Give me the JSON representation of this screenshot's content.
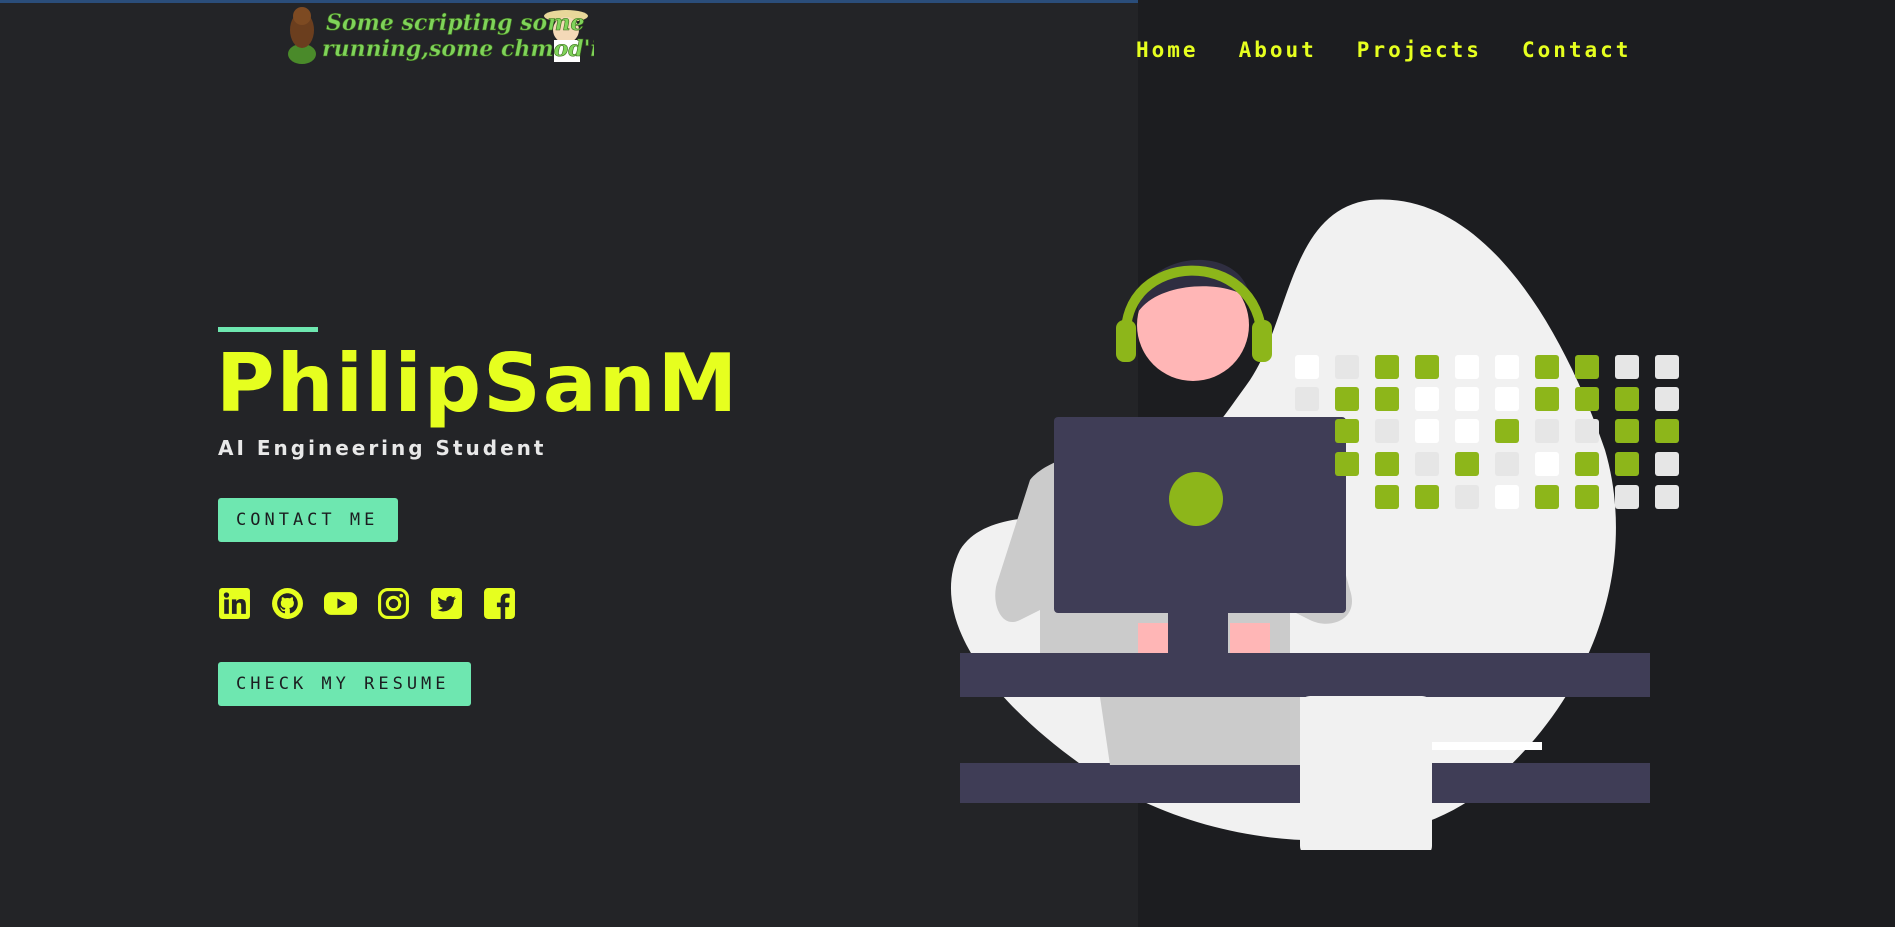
{
  "header": {
    "logo_text_line1": "Some scripting some",
    "logo_text_line2": "running,some chmod'ing",
    "nav": [
      "Home",
      "About",
      "Projects",
      "Contact"
    ]
  },
  "hero": {
    "name": "PhilipSanM",
    "role": "AI Engineering Student",
    "contact_button": "CONTACT ME",
    "resume_button": "CHECK MY RESUME"
  },
  "socials": [
    "linkedin-icon",
    "github-icon",
    "youtube-icon",
    "instagram-icon",
    "twitter-icon",
    "facebook-icon"
  ],
  "colors": {
    "background": "#232427",
    "right_panel": "#1c1d20",
    "accent_yellow": "#e6ff1f",
    "accent_mint": "#6ee7b0",
    "illustration_green": "#8db61a"
  }
}
